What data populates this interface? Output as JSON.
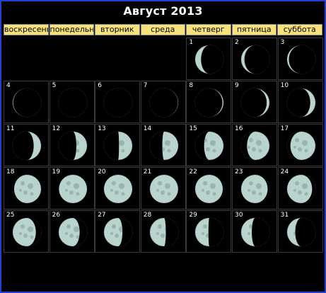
{
  "title": "Август 2013",
  "weekdays": [
    "воскресень",
    "понедельни",
    "вторник",
    "среда",
    "четверг",
    "пятница",
    "суббота"
  ],
  "calendar": {
    "first_weekday_index": 4,
    "days": [
      {
        "day": "1",
        "phase": 0.85
      },
      {
        "day": "2",
        "phase": 0.89
      },
      {
        "day": "3",
        "phase": 0.92
      },
      {
        "day": "4",
        "phase": 0.96
      },
      {
        "day": "5",
        "phase": 0.99
      },
      {
        "day": "6",
        "phase": 0.0
      },
      {
        "day": "7",
        "phase": 0.03
      },
      {
        "day": "8",
        "phase": 0.06
      },
      {
        "day": "9",
        "phase": 0.1
      },
      {
        "day": "10",
        "phase": 0.14
      },
      {
        "day": "11",
        "phase": 0.17
      },
      {
        "day": "12",
        "phase": 0.21
      },
      {
        "day": "13",
        "phase": 0.24
      },
      {
        "day": "14",
        "phase": 0.27
      },
      {
        "day": "15",
        "phase": 0.31
      },
      {
        "day": "16",
        "phase": 0.35
      },
      {
        "day": "17",
        "phase": 0.39
      },
      {
        "day": "18",
        "phase": 0.43
      },
      {
        "day": "19",
        "phase": 0.47
      },
      {
        "day": "20",
        "phase": 0.5
      },
      {
        "day": "21",
        "phase": 0.52
      },
      {
        "day": "22",
        "phase": 0.55
      },
      {
        "day": "23",
        "phase": 0.58
      },
      {
        "day": "24",
        "phase": 0.61
      },
      {
        "day": "25",
        "phase": 0.64
      },
      {
        "day": "26",
        "phase": 0.67
      },
      {
        "day": "27",
        "phase": 0.7
      },
      {
        "day": "28",
        "phase": 0.73
      },
      {
        "day": "29",
        "phase": 0.76
      },
      {
        "day": "30",
        "phase": 0.79
      },
      {
        "day": "31",
        "phase": 0.82
      }
    ]
  },
  "colors": {
    "border": "#1f3fd6",
    "header_bg": "#f7e27a",
    "moon_lit": "#b9d3cf",
    "moon_dark": "#000000",
    "rim": "#1f1f1f"
  }
}
